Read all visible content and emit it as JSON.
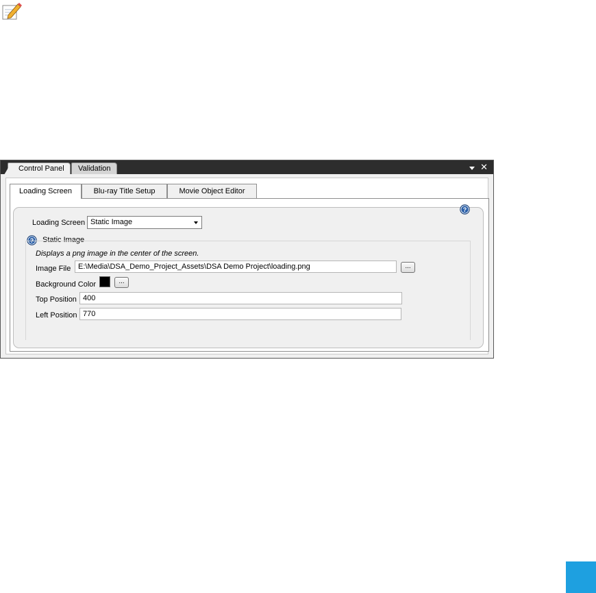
{
  "panel": {
    "tabs": [
      {
        "label": "Control Panel",
        "active": true
      },
      {
        "label": "Validation",
        "active": false
      }
    ],
    "controls": {
      "pin": "▾",
      "close": "✕"
    }
  },
  "subtabs": [
    {
      "label": "Loading Screen",
      "active": true
    },
    {
      "label": "Blu-ray Title Setup",
      "active": false
    },
    {
      "label": "Movie Object Editor",
      "active": false
    }
  ],
  "loading_screen": {
    "label": "Loading Screen",
    "selected": "Static Image"
  },
  "static_image": {
    "title": "Static Image",
    "description": "Displays a png image in the center of the screen.",
    "image_file": {
      "label": "Image File",
      "value": "E:\\Media\\DSA_Demo_Project_Assets\\DSA Demo Project\\loading.png",
      "browse": "..."
    },
    "background_color": {
      "label": "Background Color",
      "color": "#000000",
      "browse": "..."
    },
    "top_position": {
      "label": "Top Position",
      "value": "400"
    },
    "left_position": {
      "label": "Left Position",
      "value": "770"
    }
  },
  "icons": {
    "note": "notepad-pencil-icon",
    "help": "help-question-icon"
  },
  "colors": {
    "titlebar": "#2d2d2d",
    "accent_square": "#1ea0e0"
  }
}
